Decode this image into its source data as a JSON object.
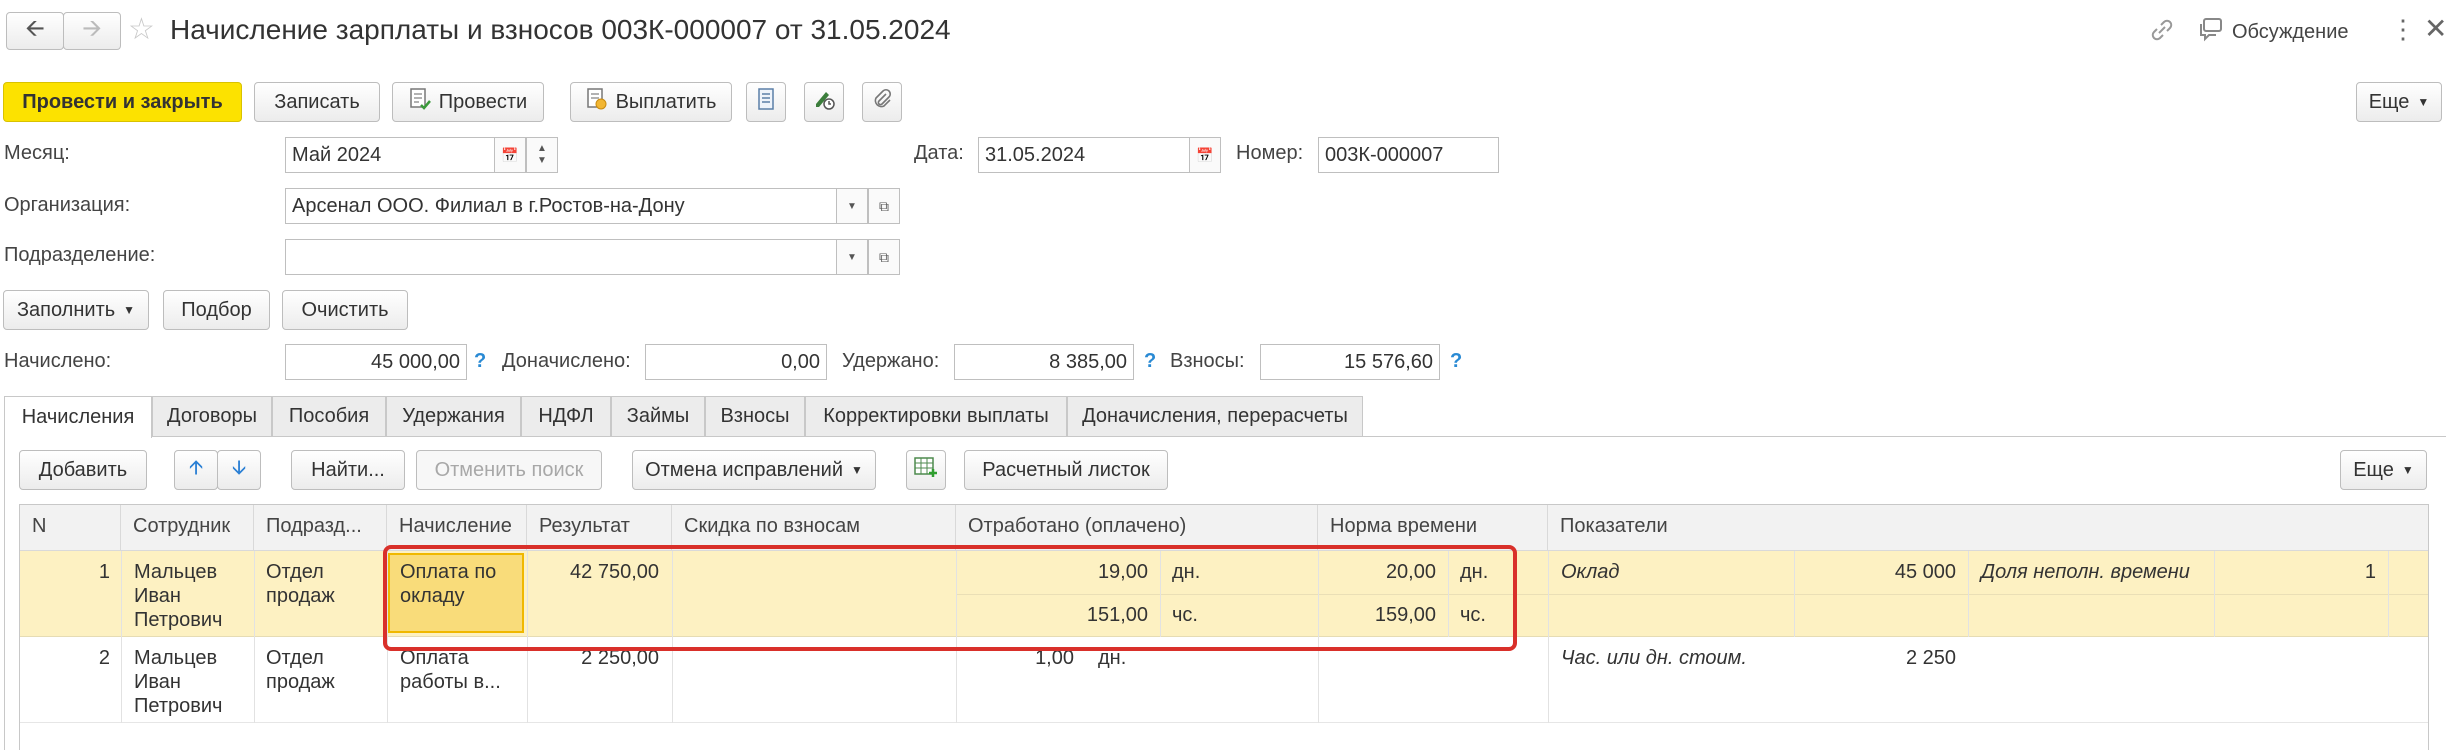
{
  "header": {
    "title": "Начисление зарплаты и взносов 003К-000007 от 31.05.2024",
    "discussion_label": "Обсуждение"
  },
  "toolbar": {
    "post_close": "Провести и закрыть",
    "save": "Записать",
    "post": "Провести",
    "pay": "Выплатить",
    "more": "Еще"
  },
  "form": {
    "month_label": "Месяц:",
    "month_value": "Май 2024",
    "date_label": "Дата:",
    "date_value": "31.05.2024",
    "number_label": "Номер:",
    "number_value": "003К-000007",
    "org_label": "Организация:",
    "org_value": "Арсенал ООО. Филиал в г.Ростов-на-Дону",
    "dept_label": "Подразделение:",
    "dept_value": ""
  },
  "actions": {
    "fill": "Заполнить",
    "pick": "Подбор",
    "clear": "Очистить"
  },
  "totals": {
    "accrued_label": "Начислено:",
    "accrued_value": "45 000,00",
    "additional_label": "Доначислено:",
    "additional_value": "0,00",
    "withheld_label": "Удержано:",
    "withheld_value": "8 385,00",
    "contrib_label": "Взносы:",
    "contrib_value": "15 576,60",
    "help": "?"
  },
  "tabs": [
    "Начисления",
    "Договоры",
    "Пособия",
    "Удержания",
    "НДФЛ",
    "Займы",
    "Взносы",
    "Корректировки выплаты",
    "Доначисления, перерасчеты"
  ],
  "table_toolbar": {
    "add": "Добавить",
    "find": "Найти...",
    "cancel_search": "Отменить поиск",
    "undo_fix": "Отмена исправлений",
    "payslip": "Расчетный листок",
    "more": "Еще"
  },
  "table": {
    "columns": [
      "N",
      "Сотрудник",
      "Подразд...",
      "Начисление",
      "Результат",
      "Скидка по взносам",
      "Отработано (оплачено)",
      "Норма времени",
      "Показатели"
    ],
    "rows": [
      {
        "n": "1",
        "employee": [
          "Мальцев",
          "Иван",
          "Петрович"
        ],
        "dept": [
          "Отдел",
          "продаж"
        ],
        "accrual": [
          "Оплата по",
          "окладу"
        ],
        "result": "42 750,00",
        "worked_days": "19,00",
        "worked_days_unit": "дн.",
        "worked_hours": "151,00",
        "worked_hours_unit": "чс.",
        "norm_days": "20,00",
        "norm_days_unit": "дн.",
        "norm_hours": "159,00",
        "norm_hours_unit": "чс.",
        "ind1_name": "Оклад",
        "ind1_value": "45 000",
        "ind2_name": "Доля неполн. времени",
        "ind2_value": "1"
      },
      {
        "n": "2",
        "employee": [
          "Мальцев",
          "Иван",
          "Петрович"
        ],
        "dept": [
          "Отдел",
          "продаж"
        ],
        "accrual": [
          "Оплата",
          "работы в..."
        ],
        "result": "2 250,00",
        "worked_days": "1,00",
        "worked_days_unit": "дн.",
        "ind1_name": "Час. или дн. стоим.",
        "ind1_value": "2 250"
      }
    ]
  },
  "colors": {
    "accent_yellow": "#fce200",
    "row_selected": "#fdf1c2",
    "cell_selected": "#f9dc7a",
    "highlight_red": "#d9302a",
    "help_blue": "#2a8ad4"
  }
}
